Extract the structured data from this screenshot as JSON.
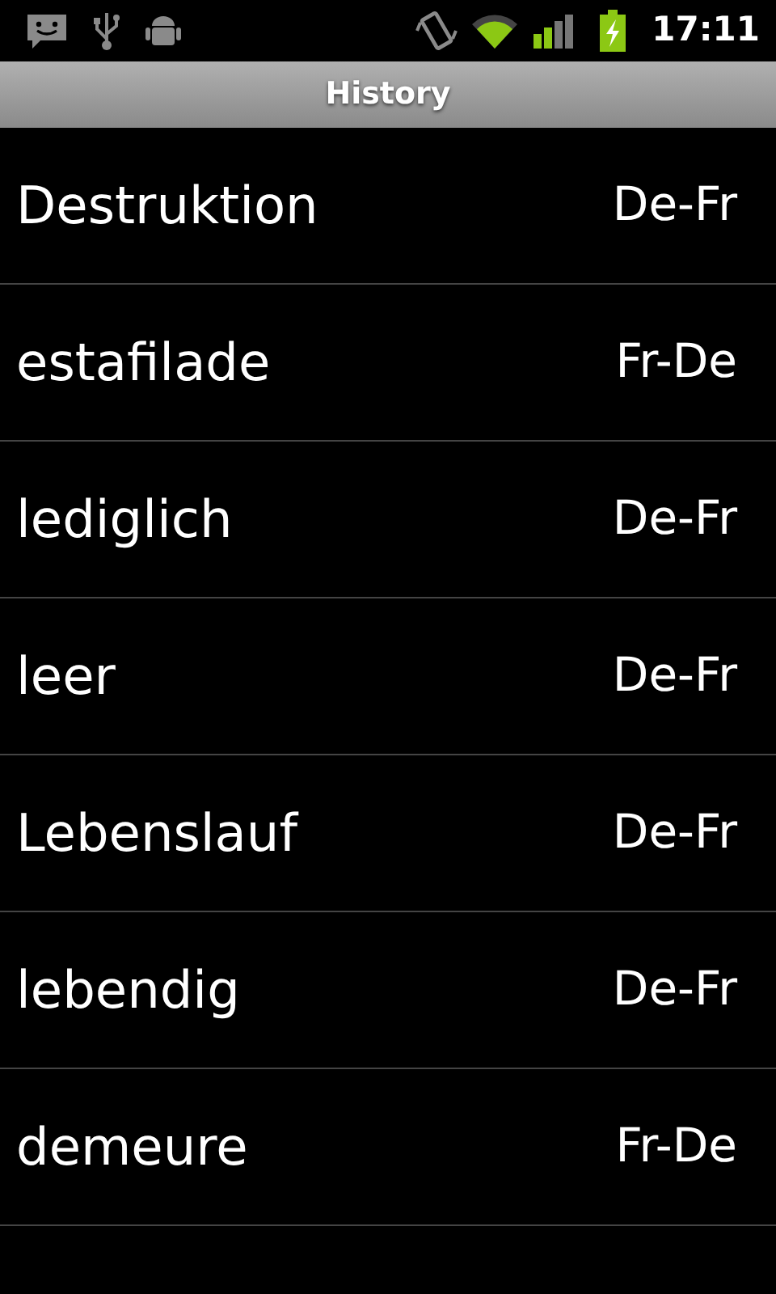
{
  "status_bar": {
    "time": "17:11"
  },
  "title_bar": {
    "title": "History"
  },
  "history": [
    {
      "word": "Destruktion",
      "direction": "De-Fr"
    },
    {
      "word": "estafilade",
      "direction": "Fr-De"
    },
    {
      "word": "lediglich",
      "direction": "De-Fr"
    },
    {
      "word": "leer",
      "direction": "De-Fr"
    },
    {
      "word": "Lebenslauf",
      "direction": "De-Fr"
    },
    {
      "word": "lebendig",
      "direction": "De-Fr"
    },
    {
      "word": "demeure",
      "direction": "Fr-De"
    }
  ]
}
